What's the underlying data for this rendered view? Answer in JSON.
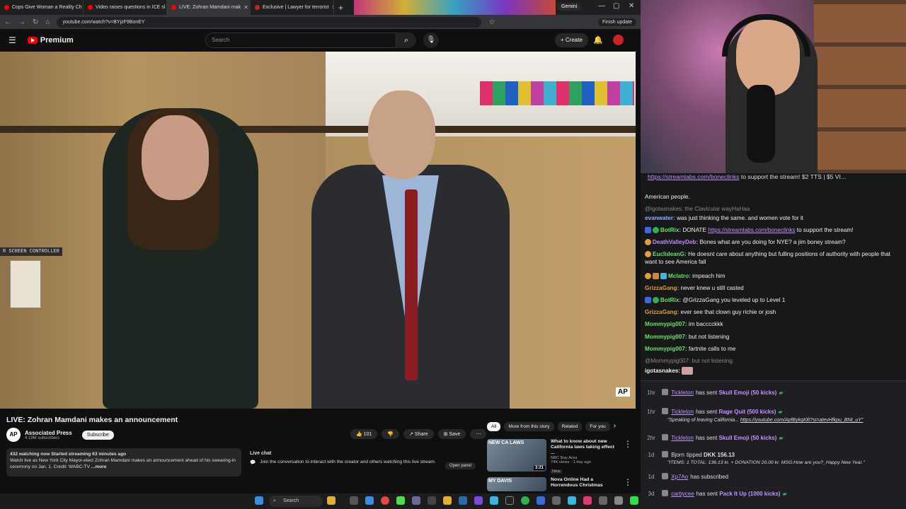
{
  "browser": {
    "tabs": [
      {
        "label": "Cops Give Woman a Reality Ch"
      },
      {
        "label": "Video raises questions in ICE sl"
      },
      {
        "label": "LIVE: Zohran Mamdani mak"
      },
      {
        "label": "Exclusive | Lawyer for terrorist"
      }
    ],
    "gemini_label": "Gemini",
    "url": "youtube.com/watch?v=BYjzF9BonEY",
    "finish_update": "Finish update"
  },
  "youtube": {
    "brand": "Premium",
    "search_placeholder": "Search",
    "create_label": "Create",
    "video_overlay_label": "R SCREEN CONTROLLER",
    "watermark": "AP",
    "title": "LIVE: Zohran Mamdani makes an announcement",
    "channel": {
      "logo": "AP",
      "name": "Associated Press",
      "subs": "4.19M subscribers",
      "subscribe": "Subscribe"
    },
    "likes": "101",
    "share": "Share",
    "save": "Save",
    "description_stats": "432 watching now  Started streaming 63 minutes ago",
    "description_text": "Watch live as New York City Mayor-elect Zohran Mamdani makes an announcement ahead of his swearing-in ceremony on Jan. 1. Credit: WABC-TV",
    "description_more": "...more",
    "live_chat": {
      "title": "Live chat",
      "text": "Join the conversation to interact with the creator and others watching this live stream.",
      "open_panel": "Open panel"
    },
    "chips": [
      "All",
      "More from this story",
      "Related",
      "For you"
    ],
    "recs": [
      {
        "thumb_text": "NEW CA LAWS",
        "duration": "3:21",
        "title": "What to know about new California laws taking effect ...",
        "channel": "NBC Bay Area",
        "meta": "74K views · 1 day ago",
        "tag": "New"
      },
      {
        "thumb_text": "MY DAVIS",
        "title": "Nova Online Had a Horrendous Christmas"
      }
    ]
  },
  "chat": {
    "pinned_link": "https://streamlabs.com/boneclinks",
    "pinned_text": "to support the stream! $2 TTS | $5 VI...",
    "messages": [
      {
        "user": "",
        "text": "American people."
      },
      {
        "user": "",
        "reply": "@igotasnakes: the Clavicular wayHaHaa"
      },
      {
        "user": "evanwater:",
        "text": "was just thinking the same. and women vote for it",
        "color": "#8fb1ff"
      },
      {
        "user": "BotRix:",
        "text": "DONATE",
        "link": "https://streamlabs.com/boneclinks",
        "text2": "to support the stream!",
        "color": "#6ae06a"
      },
      {
        "user": "DeathValleyDeb:",
        "text": "Bones what are you doing for NYE? a jim boney stream?",
        "color": "#c78bff"
      },
      {
        "user": "EuclideanG:",
        "text": "He doesnt care about anything but fulling positions of authority with people that want to see America fall",
        "color": "#6ae06a"
      },
      {
        "user": "Mclatro:",
        "text": "impeach him",
        "color": "#6ae06a"
      },
      {
        "user": "GrizzaGang:",
        "text": "never knew u still casted",
        "color": "#e0a03a"
      },
      {
        "user": "BotRix:",
        "text": "@GrizzaGang you leveled up to Level 1",
        "color": "#6ae06a"
      },
      {
        "user": "GrizzaGang:",
        "text": "ever see that clown guy richie or josh",
        "color": "#e0a03a"
      },
      {
        "user": "Mommypig007:",
        "text": "im bacccckkk",
        "color": "#6ae06a"
      },
      {
        "user": "Mommypig007:",
        "text": "but not listening",
        "color": "#6ae06a"
      },
      {
        "user": "Mommypig007:",
        "text": "fartnite calls to me",
        "color": "#6ae06a"
      },
      {
        "user": "",
        "reply": "@Mommypig007: but not listening"
      },
      {
        "user": "igotasnakes:",
        "text": "",
        "color": "#efeff1"
      }
    ],
    "events": [
      {
        "time": "1hr",
        "user": "Tickleton",
        "text": "has sent",
        "item": "Skull Emoji (50 kicks)"
      },
      {
        "time": "1hr",
        "user": "Tickleton",
        "text": "has sent",
        "item": "Rage Quit (500 kicks)",
        "note": "\"Speaking of leaving California...",
        "note_link": "https://youtube.com/ApfBykqI0lI?si=atevHfkpu_BNt_uY\""
      },
      {
        "time": "2hr",
        "user": "Tickleton",
        "text": "has sent",
        "item": "Skull Emoji (50 kicks)"
      },
      {
        "time": "1d",
        "user": "Bjorn",
        "text": "tipped",
        "item": "DKK 156.13",
        "note": "\"ITEMS: 1 TOTAL: 136.13 kr. + DONATION 20.00 kr. MSG:How are you?_Happy New Year.\""
      },
      {
        "time": "1d",
        "user": "Xp7Ao",
        "text": "has subscribed"
      },
      {
        "time": "3d",
        "user": "carbycee",
        "text": "has sent",
        "item": "Pack It Up (1000 kicks)"
      }
    ]
  },
  "taskbar": {
    "search": "Search"
  }
}
